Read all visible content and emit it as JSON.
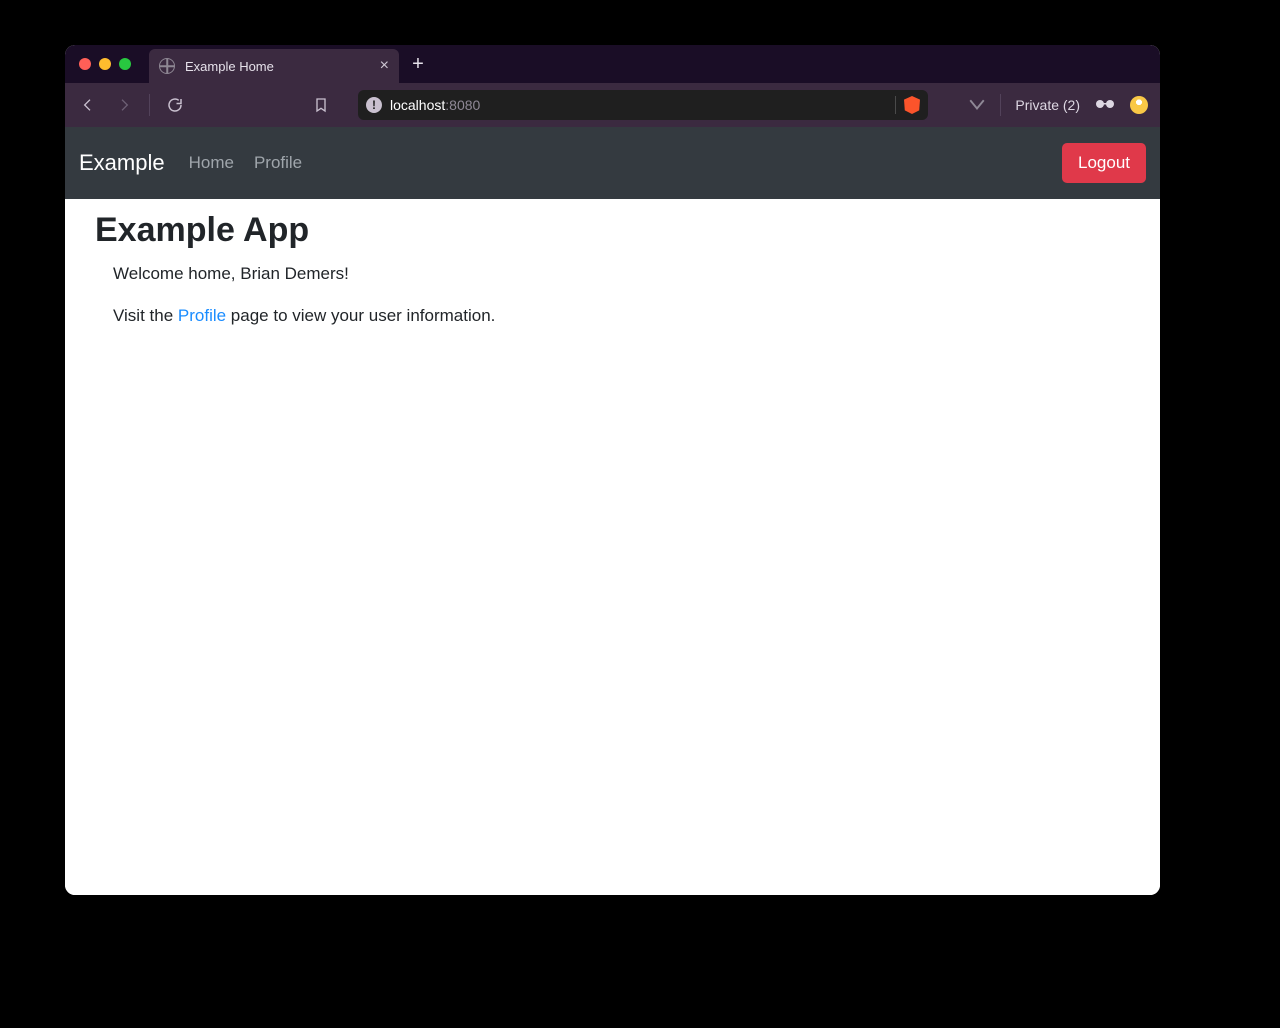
{
  "browser": {
    "tab_title": "Example Home",
    "url_host": "localhost",
    "url_port": ":8080",
    "private_label": "Private (2)"
  },
  "navbar": {
    "brand": "Example",
    "links": {
      "home": "Home",
      "profile": "Profile"
    },
    "logout": "Logout"
  },
  "page": {
    "heading": "Example App",
    "welcome": "Welcome home, Brian Demers!",
    "visit_pre": "Visit the ",
    "visit_link": "Profile",
    "visit_post": " page to view your user information."
  }
}
